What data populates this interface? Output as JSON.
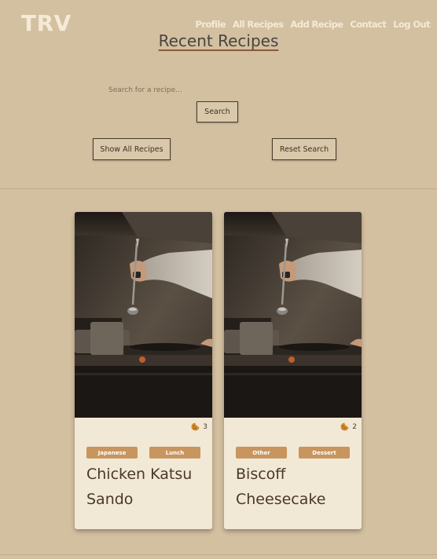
{
  "brand": {
    "logo": "TRV"
  },
  "nav": {
    "items": [
      {
        "label": "Profile"
      },
      {
        "label": "All Recipes"
      },
      {
        "label": "Add Recipe"
      },
      {
        "label": "Contact"
      },
      {
        "label": "Log Out"
      }
    ]
  },
  "header": {
    "title": "Recent Recipes"
  },
  "search": {
    "placeholder": "Search for a recipe...",
    "value": "",
    "button_label": "Search"
  },
  "actions": {
    "show_all_label": "Show All Recipes",
    "reset_label": "Reset Search"
  },
  "recipes": [
    {
      "title": "Chicken Katsu Sando",
      "tags": [
        "Japanese",
        "Lunch"
      ],
      "likes": "3",
      "like_icon": "cookie-icon"
    },
    {
      "title": "Biscoff Cheesecake",
      "tags": [
        "Other",
        "Dessert"
      ],
      "likes": "2",
      "like_icon": "cookie-icon"
    }
  ],
  "colors": {
    "background": "#d3c0a0",
    "card": "#f2e8d6",
    "tag": "#c8955f",
    "nav_text": "#f4ead7",
    "title_underline": "#8a5a3a"
  }
}
